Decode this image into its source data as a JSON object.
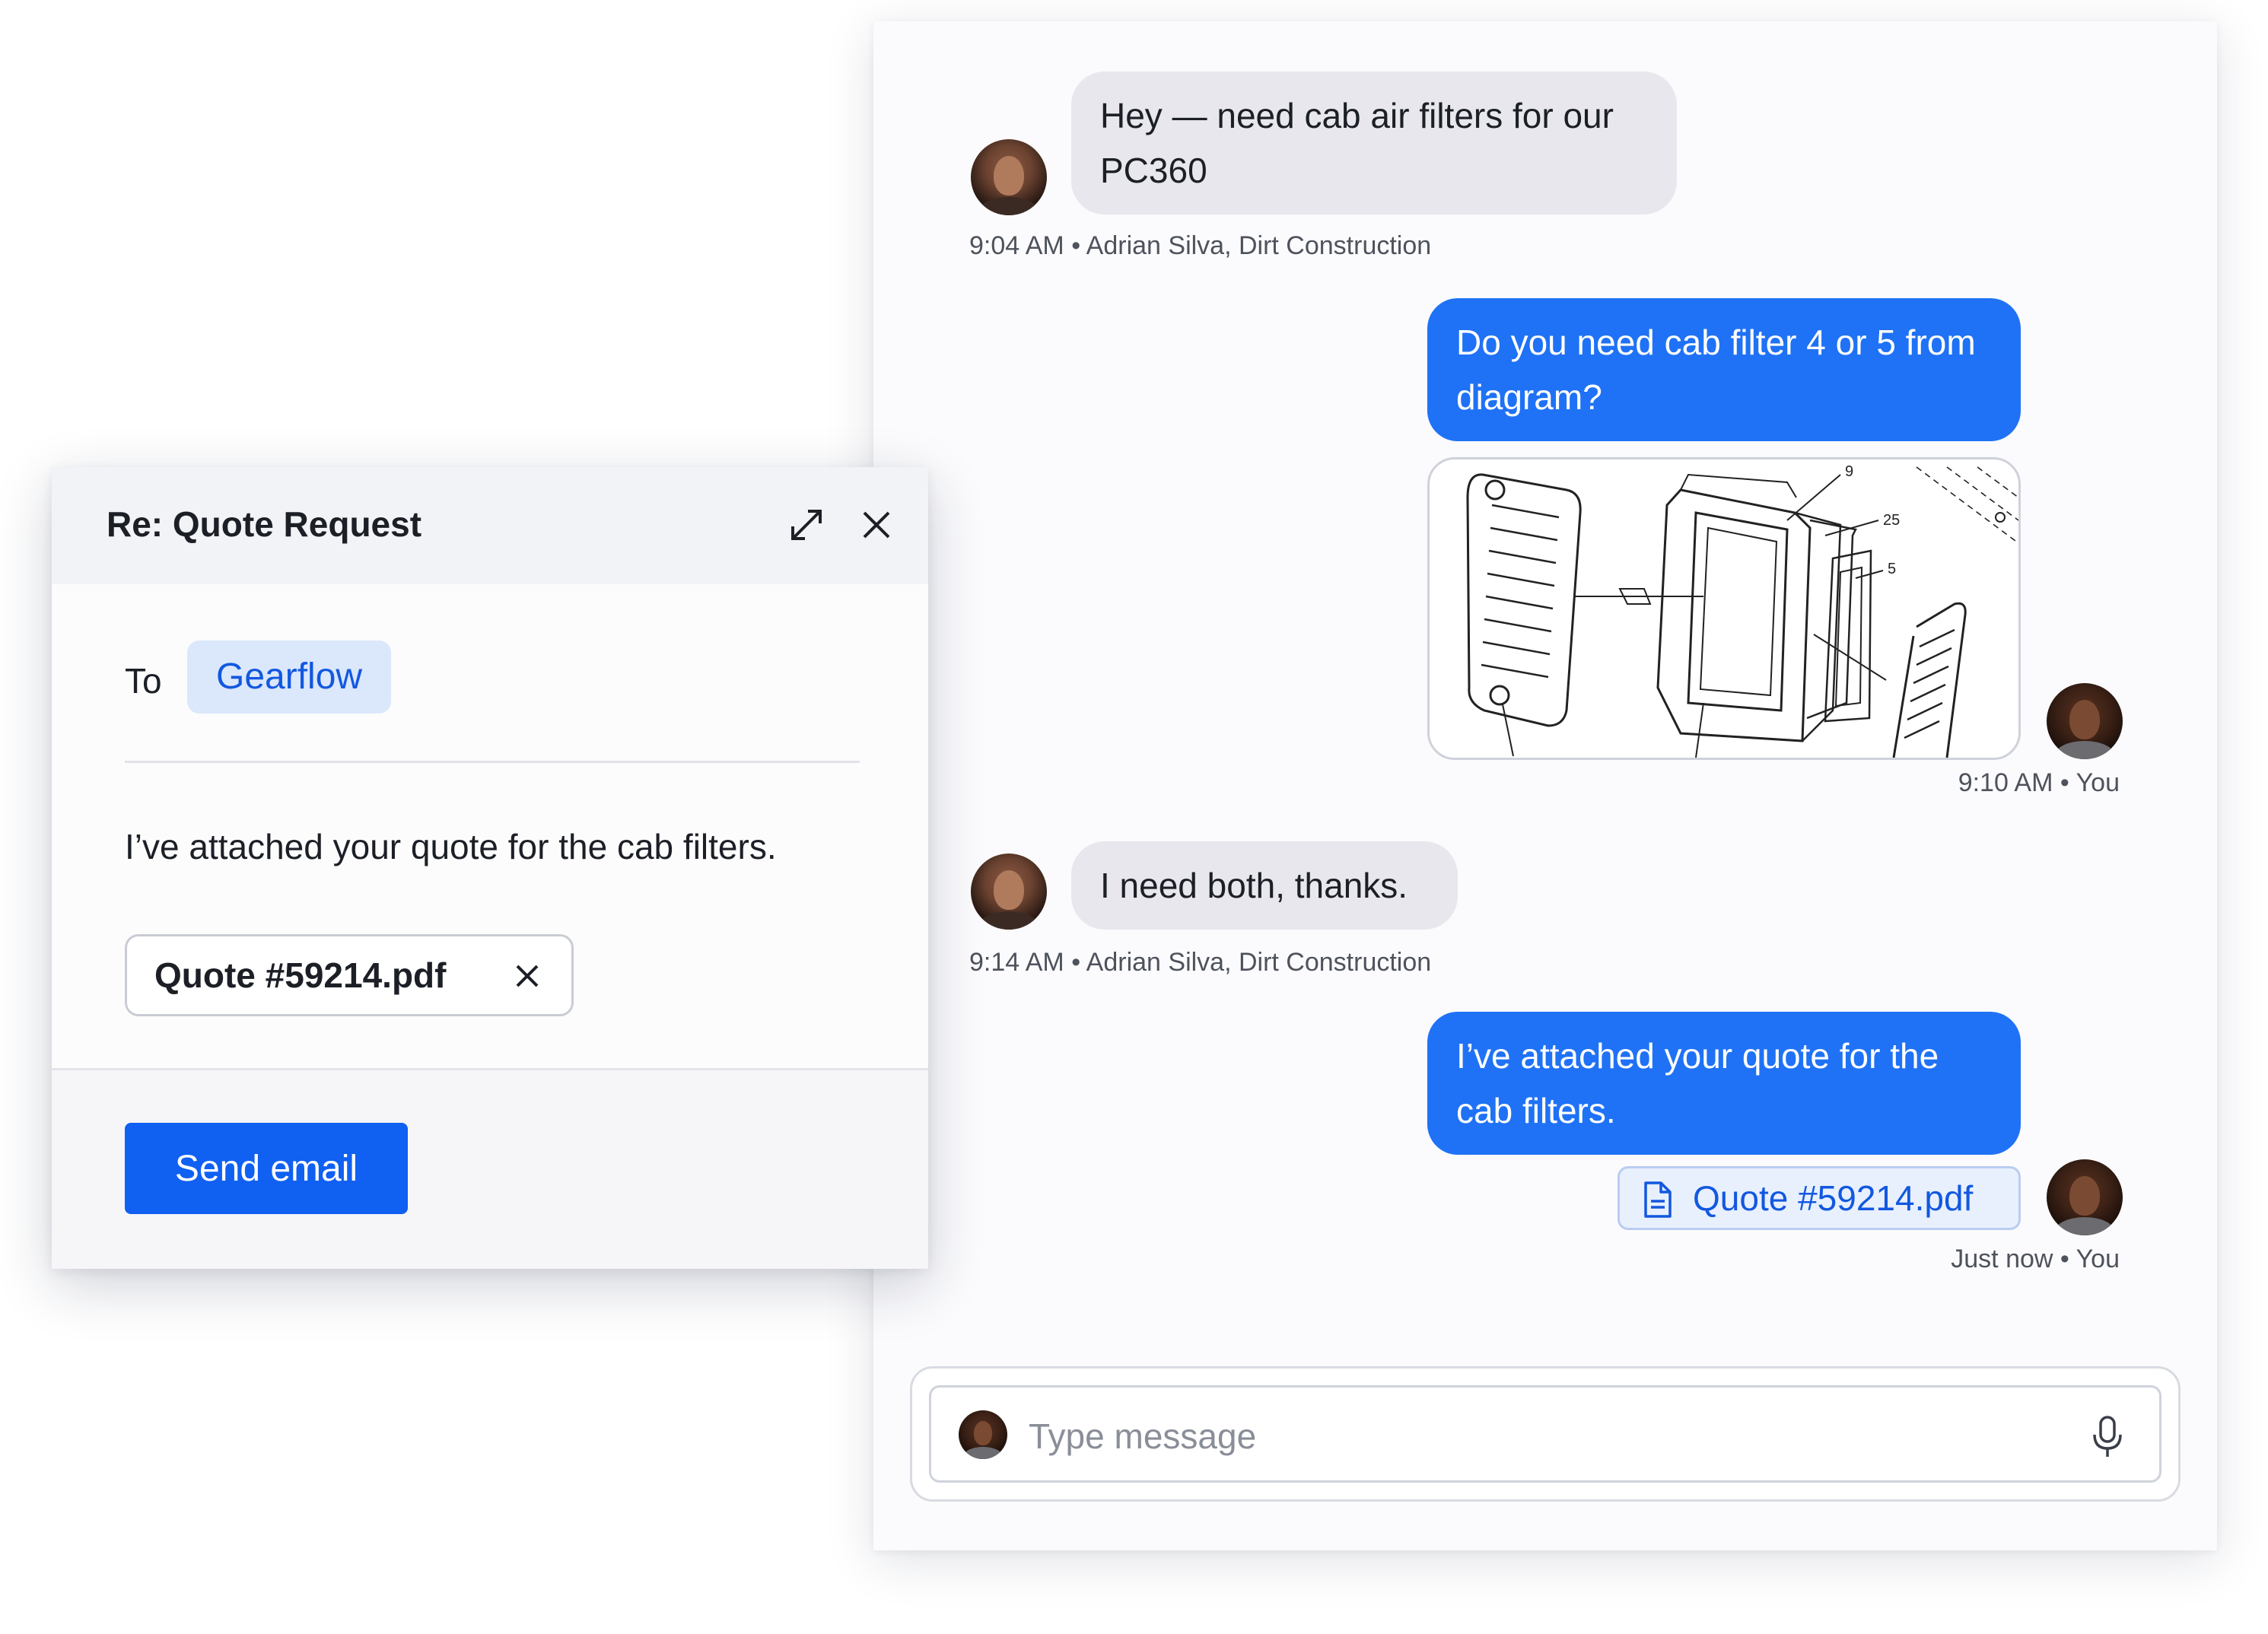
{
  "chat": {
    "messages": [
      {
        "direction": "incoming",
        "text": "Hey — need cab air filters for our PC360",
        "meta": "9:04 AM • Adrian Silva, Dirt Construction"
      },
      {
        "direction": "outgoing",
        "text": "Do you need cab filter 4 or 5 from diagram?",
        "diagram_labels": [
          "9",
          "25",
          "5"
        ],
        "meta": "9:10 AM • You"
      },
      {
        "direction": "incoming",
        "text": "I need both, thanks.",
        "meta": "9:14 AM • Adrian Silva, Dirt Construction"
      },
      {
        "direction": "outgoing",
        "text": "I’ve attached your quote for the cab filters.",
        "attachment": "Quote #59214.pdf",
        "meta": "Just now • You"
      }
    ],
    "composer": {
      "placeholder": "Type message",
      "mic_icon": "microphone-icon"
    }
  },
  "email": {
    "title": "Re: Quote Request",
    "expand_icon": "expand-icon",
    "close_icon": "close-icon",
    "to_label": "To",
    "recipient": "Gearflow",
    "body": "I’ve attached your quote for the cab filters.",
    "attachment": "Quote #59214.pdf",
    "send_label": "Send email"
  },
  "colors": {
    "accent_blue": "#1f72f5",
    "send_button": "#1060f2",
    "incoming_bubble": "#e7e7ed",
    "link_blue": "#1258e0",
    "chip_bg": "#dbe7fb"
  }
}
